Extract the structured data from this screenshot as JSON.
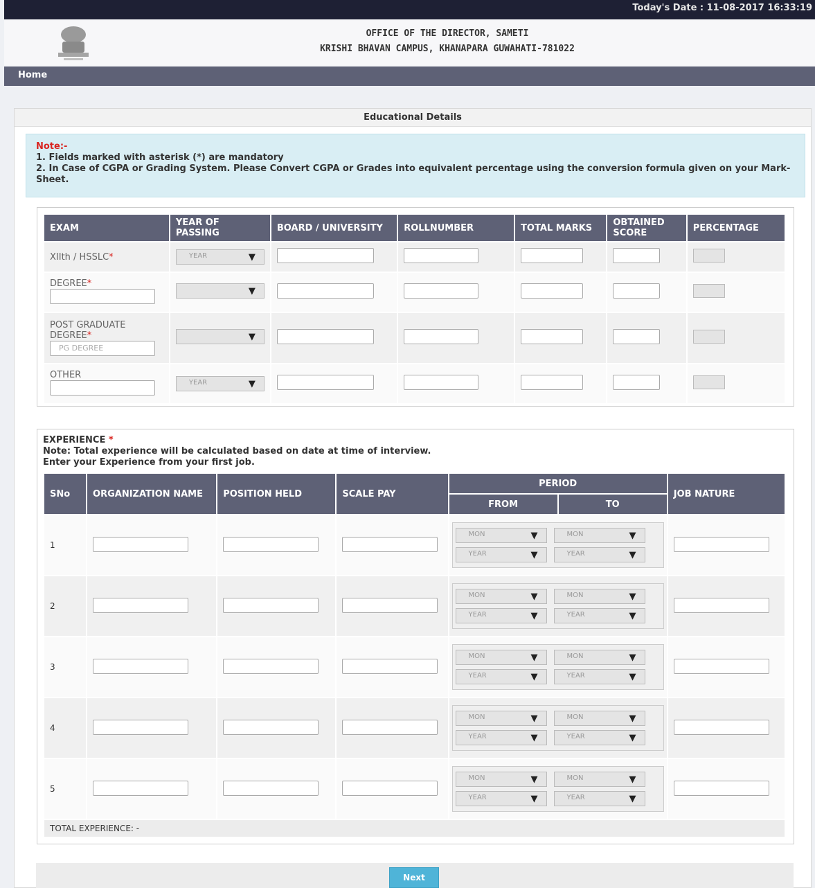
{
  "topbar": {
    "date_text": "Today's Date : 11-08-2017 16:33:19"
  },
  "header": {
    "office_line1": "OFFICE OF THE DIRECTOR, SAMETI",
    "office_line2": "KRISHI BHAVAN CAMPUS, KHANAPARA GUWAHATI-781022"
  },
  "nav": {
    "home": "Home"
  },
  "section": {
    "title": "Educational Details"
  },
  "note": {
    "title": "Note:-",
    "line1": "1. Fields marked with asterisk (*) are mandatory",
    "line2": "2. In Case of CGPA or Grading System. Please Convert CGPA or Grades into equivalent percentage using the conversion formula given on your Mark-Sheet."
  },
  "education": {
    "headers": [
      "EXAM",
      "YEAR OF PASSING",
      "BOARD / UNIVERSITY",
      "ROLLNUMBER",
      "TOTAL MARKS",
      "OBTAINED SCORE",
      "PERCENTAGE"
    ],
    "rows": [
      {
        "exam": "XIIth / HSSLC",
        "required": "*",
        "year_placeholder": "YEAR"
      },
      {
        "exam": "DEGREE",
        "required": "*",
        "year_placeholder": ""
      },
      {
        "exam": "POST GRADUATE DEGREE",
        "required": "*",
        "year_placeholder": "",
        "input_placeholder": "PG DEGREE"
      },
      {
        "exam": "OTHER",
        "required": "",
        "year_placeholder": "YEAR"
      }
    ]
  },
  "experience": {
    "title": "EXPERIENCE",
    "required": "*",
    "note1": "Note: Total experience will be calculated based on date at time of interview.",
    "note2": "Enter your Experience from your first job.",
    "headers": {
      "sno": "SNo",
      "org": "ORGANIZATION NAME",
      "position": "POSITION HELD",
      "scale": "SCALE PAY",
      "period": "PERIOD",
      "from": "FROM",
      "to": "TO",
      "nature": "JOB NATURE"
    },
    "month_placeholder": "MON",
    "year_placeholder": "YEAR",
    "rows": [
      "1",
      "2",
      "3",
      "4",
      "5"
    ],
    "total_label": "TOTAL EXPERIENCE: -"
  },
  "footer": {
    "next_label": "Next"
  }
}
